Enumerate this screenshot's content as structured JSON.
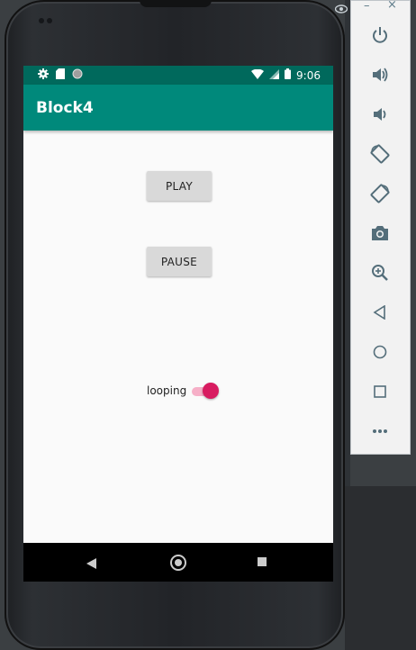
{
  "status_bar": {
    "time": "9:06"
  },
  "app": {
    "title": "Block4"
  },
  "buttons": {
    "play": "PLAY",
    "pause": "PAUSE"
  },
  "looping": {
    "label": "looping",
    "checked": true
  },
  "emulator_toolbar": {
    "minimize": "–",
    "close": "×",
    "tools": [
      "power-icon",
      "volume-up-icon",
      "volume-down-icon",
      "rotate-left-icon",
      "rotate-right-icon",
      "camera-icon",
      "zoom-icon",
      "back-icon",
      "home-icon",
      "overview-icon",
      "more-icon"
    ]
  },
  "colors": {
    "status_bar": "#00695c",
    "app_bar": "#00897b",
    "accent": "#d81b60",
    "button": "#d9d9d9"
  }
}
